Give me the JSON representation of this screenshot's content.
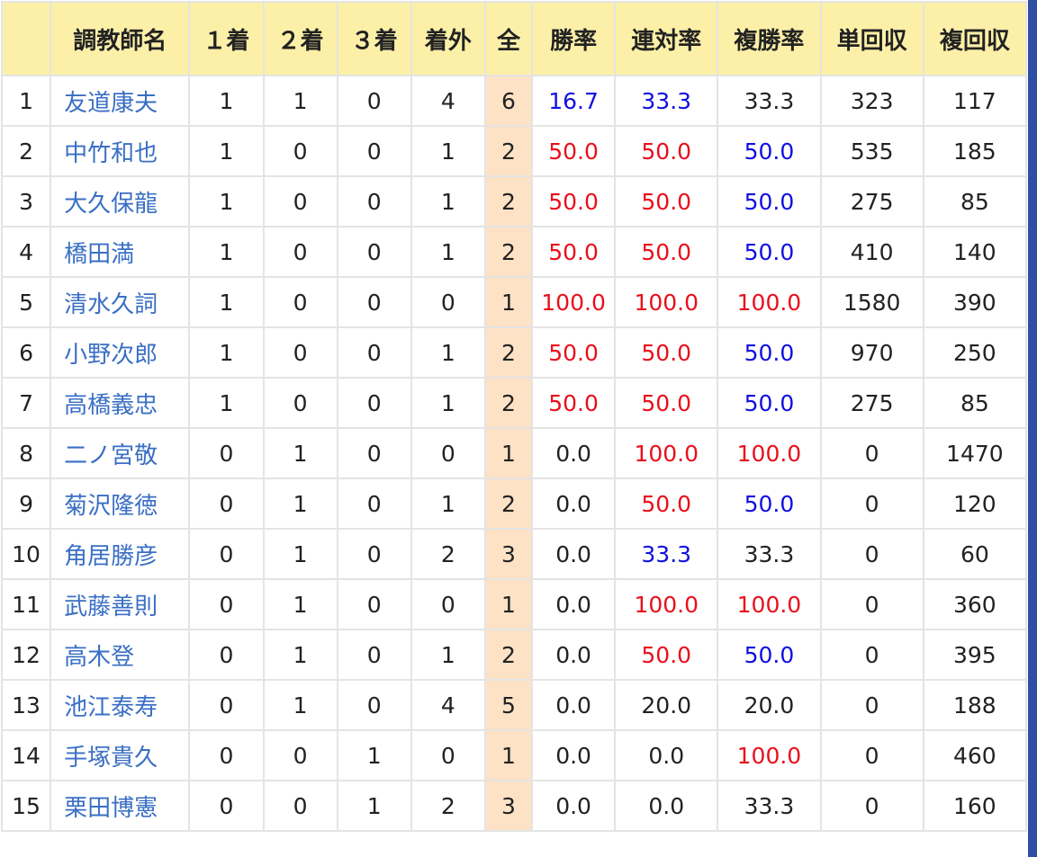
{
  "colors": {
    "header_bg": "#fcf0a8",
    "total_col_bg": "#fde2c6",
    "link": "#3a6fc4",
    "red": "#e8101b",
    "blue": "#1010e0",
    "right_bar": "#2f4fa5"
  },
  "table": {
    "headers": [
      "",
      "調教師名",
      "１着",
      "２着",
      "３着",
      "着外",
      "全",
      "勝率",
      "連対率",
      "複勝率",
      "単回収",
      "複回収"
    ],
    "rows": [
      {
        "rank": "1",
        "name": "友道康夫",
        "first": "1",
        "second": "1",
        "third": "0",
        "out": "4",
        "total": "6",
        "win_rate": "16.7",
        "win_rate_color": "blue",
        "quinella_rate": "33.3",
        "quinella_rate_color": "blue",
        "place_rate": "33.3",
        "place_rate_color": "plain",
        "win_return": "323",
        "place_return": "117"
      },
      {
        "rank": "2",
        "name": "中竹和也",
        "first": "1",
        "second": "0",
        "third": "0",
        "out": "1",
        "total": "2",
        "win_rate": "50.0",
        "win_rate_color": "red",
        "quinella_rate": "50.0",
        "quinella_rate_color": "red",
        "place_rate": "50.0",
        "place_rate_color": "blue",
        "win_return": "535",
        "place_return": "185"
      },
      {
        "rank": "3",
        "name": "大久保龍",
        "first": "1",
        "second": "0",
        "third": "0",
        "out": "1",
        "total": "2",
        "win_rate": "50.0",
        "win_rate_color": "red",
        "quinella_rate": "50.0",
        "quinella_rate_color": "red",
        "place_rate": "50.0",
        "place_rate_color": "blue",
        "win_return": "275",
        "place_return": "85"
      },
      {
        "rank": "4",
        "name": "橋田満",
        "first": "1",
        "second": "0",
        "third": "0",
        "out": "1",
        "total": "2",
        "win_rate": "50.0",
        "win_rate_color": "red",
        "quinella_rate": "50.0",
        "quinella_rate_color": "red",
        "place_rate": "50.0",
        "place_rate_color": "blue",
        "win_return": "410",
        "place_return": "140"
      },
      {
        "rank": "5",
        "name": "清水久詞",
        "first": "1",
        "second": "0",
        "third": "0",
        "out": "0",
        "total": "1",
        "win_rate": "100.0",
        "win_rate_color": "red",
        "quinella_rate": "100.0",
        "quinella_rate_color": "red",
        "place_rate": "100.0",
        "place_rate_color": "red",
        "win_return": "1580",
        "place_return": "390"
      },
      {
        "rank": "6",
        "name": "小野次郎",
        "first": "1",
        "second": "0",
        "third": "0",
        "out": "1",
        "total": "2",
        "win_rate": "50.0",
        "win_rate_color": "red",
        "quinella_rate": "50.0",
        "quinella_rate_color": "red",
        "place_rate": "50.0",
        "place_rate_color": "blue",
        "win_return": "970",
        "place_return": "250"
      },
      {
        "rank": "7",
        "name": "高橋義忠",
        "first": "1",
        "second": "0",
        "third": "0",
        "out": "1",
        "total": "2",
        "win_rate": "50.0",
        "win_rate_color": "red",
        "quinella_rate": "50.0",
        "quinella_rate_color": "red",
        "place_rate": "50.0",
        "place_rate_color": "blue",
        "win_return": "275",
        "place_return": "85"
      },
      {
        "rank": "8",
        "name": "二ノ宮敬",
        "first": "0",
        "second": "1",
        "third": "0",
        "out": "0",
        "total": "1",
        "win_rate": "0.0",
        "win_rate_color": "plain",
        "quinella_rate": "100.0",
        "quinella_rate_color": "red",
        "place_rate": "100.0",
        "place_rate_color": "red",
        "win_return": "0",
        "place_return": "1470"
      },
      {
        "rank": "9",
        "name": "菊沢隆徳",
        "first": "0",
        "second": "1",
        "third": "0",
        "out": "1",
        "total": "2",
        "win_rate": "0.0",
        "win_rate_color": "plain",
        "quinella_rate": "50.0",
        "quinella_rate_color": "red",
        "place_rate": "50.0",
        "place_rate_color": "blue",
        "win_return": "0",
        "place_return": "120"
      },
      {
        "rank": "10",
        "name": "角居勝彦",
        "first": "0",
        "second": "1",
        "third": "0",
        "out": "2",
        "total": "3",
        "win_rate": "0.0",
        "win_rate_color": "plain",
        "quinella_rate": "33.3",
        "quinella_rate_color": "blue",
        "place_rate": "33.3",
        "place_rate_color": "plain",
        "win_return": "0",
        "place_return": "60"
      },
      {
        "rank": "11",
        "name": "武藤善則",
        "first": "0",
        "second": "1",
        "third": "0",
        "out": "0",
        "total": "1",
        "win_rate": "0.0",
        "win_rate_color": "plain",
        "quinella_rate": "100.0",
        "quinella_rate_color": "red",
        "place_rate": "100.0",
        "place_rate_color": "red",
        "win_return": "0",
        "place_return": "360"
      },
      {
        "rank": "12",
        "name": "高木登",
        "first": "0",
        "second": "1",
        "third": "0",
        "out": "1",
        "total": "2",
        "win_rate": "0.0",
        "win_rate_color": "plain",
        "quinella_rate": "50.0",
        "quinella_rate_color": "red",
        "place_rate": "50.0",
        "place_rate_color": "blue",
        "win_return": "0",
        "place_return": "395"
      },
      {
        "rank": "13",
        "name": "池江泰寿",
        "first": "0",
        "second": "1",
        "third": "0",
        "out": "4",
        "total": "5",
        "win_rate": "0.0",
        "win_rate_color": "plain",
        "quinella_rate": "20.0",
        "quinella_rate_color": "plain",
        "place_rate": "20.0",
        "place_rate_color": "plain",
        "win_return": "0",
        "place_return": "188"
      },
      {
        "rank": "14",
        "name": "手塚貴久",
        "first": "0",
        "second": "0",
        "third": "1",
        "out": "0",
        "total": "1",
        "win_rate": "0.0",
        "win_rate_color": "plain",
        "quinella_rate": "0.0",
        "quinella_rate_color": "plain",
        "place_rate": "100.0",
        "place_rate_color": "red",
        "win_return": "0",
        "place_return": "460"
      },
      {
        "rank": "15",
        "name": "栗田博憲",
        "first": "0",
        "second": "0",
        "third": "1",
        "out": "2",
        "total": "3",
        "win_rate": "0.0",
        "win_rate_color": "plain",
        "quinella_rate": "0.0",
        "quinella_rate_color": "plain",
        "place_rate": "33.3",
        "place_rate_color": "plain",
        "win_return": "0",
        "place_return": "160"
      }
    ]
  }
}
